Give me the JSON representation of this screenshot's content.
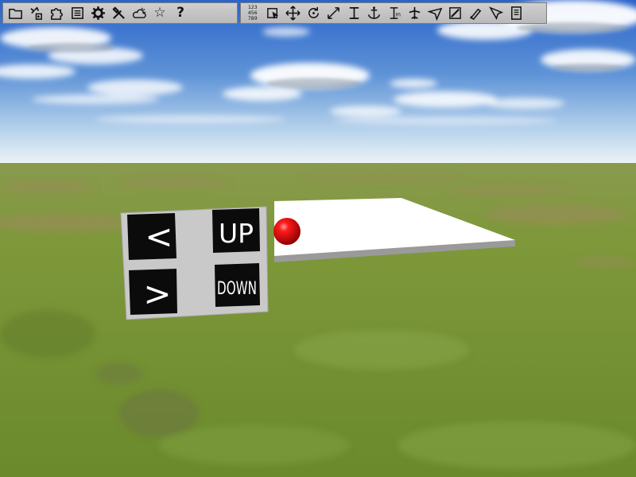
{
  "toolbar_left": [
    {
      "icon": "folder-icon"
    },
    {
      "icon": "add-object-icon"
    },
    {
      "icon": "puzzle-icon"
    },
    {
      "icon": "list-icon"
    },
    {
      "icon": "gear-icon"
    },
    {
      "icon": "tools-icon"
    },
    {
      "icon": "weather-icon"
    },
    {
      "icon": "star-icon",
      "glyph": "☆"
    },
    {
      "icon": "help-icon",
      "glyph": "?"
    }
  ],
  "toolbar_right": [
    {
      "icon": "numbering-icon",
      "lines": [
        "123",
        "456",
        "789"
      ]
    },
    {
      "icon": "select-box-icon"
    },
    {
      "icon": "move-icon"
    },
    {
      "icon": "rotate-icon"
    },
    {
      "icon": "scale-icon"
    },
    {
      "icon": "align-height-icon"
    },
    {
      "icon": "anchor-icon"
    },
    {
      "icon": "measure-icon"
    },
    {
      "icon": "aircraft-icon"
    },
    {
      "icon": "glider-icon"
    },
    {
      "icon": "edit-shape-icon"
    },
    {
      "icon": "brush-icon"
    },
    {
      "icon": "flag-icon"
    },
    {
      "icon": "notes-icon"
    }
  ],
  "control_panel": {
    "up_arrow": "<",
    "up_label": "UP",
    "down_arrow": ">",
    "down_label": "DOWN"
  },
  "colors": {
    "sky_top": "#2f66c8",
    "sky_horizon": "#e9f1f6",
    "grass": "#6f8a32",
    "panel": "#c9c9c9",
    "button": "#0b0b0b",
    "platform": "#ffffff",
    "ball": "#e00000"
  }
}
